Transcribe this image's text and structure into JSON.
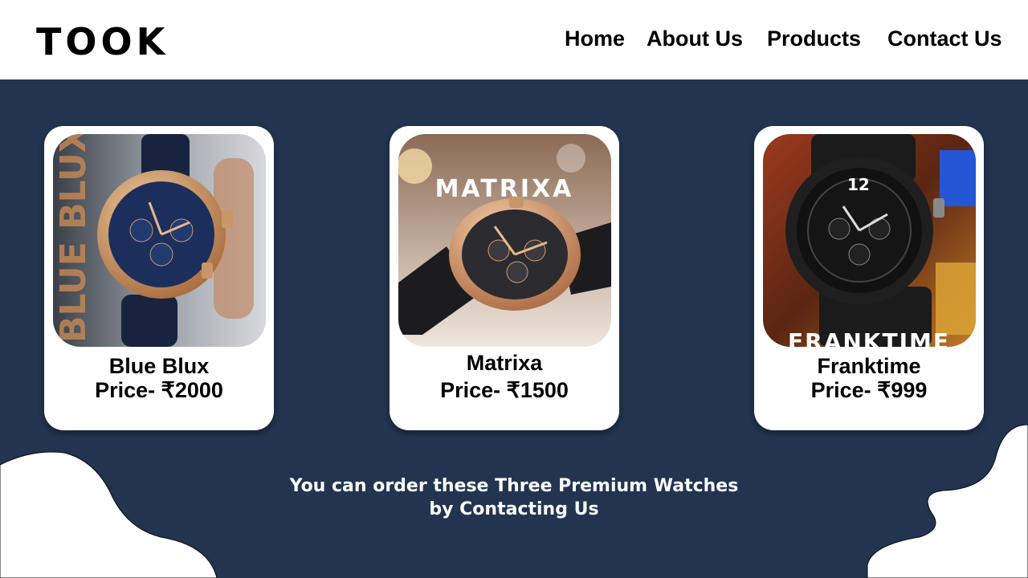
{
  "brand": {
    "logo": "TOOK"
  },
  "nav": {
    "home": "Home",
    "about": "About Us",
    "products": "Products",
    "contact": "Contact Us"
  },
  "products": [
    {
      "name": "Blue Blux",
      "price": "Price- ₹2000",
      "image_text": "BLUE BLUX",
      "dial_color": "#1c2f5c"
    },
    {
      "name": "Matrixa",
      "price": "Price- ₹1500",
      "image_text": "MATRIXA",
      "dial_color": "#2b2b30"
    },
    {
      "name": "Franktime",
      "price": "Price- ₹999",
      "image_text": "FRANKTIME",
      "dial_color": "#111111"
    }
  ],
  "footer": {
    "line1": "You can order these Three Premium Watches",
    "line2": "by Contacting Us"
  },
  "colors": {
    "background": "#22344f",
    "header": "#ffffff",
    "card": "#ffffff"
  }
}
